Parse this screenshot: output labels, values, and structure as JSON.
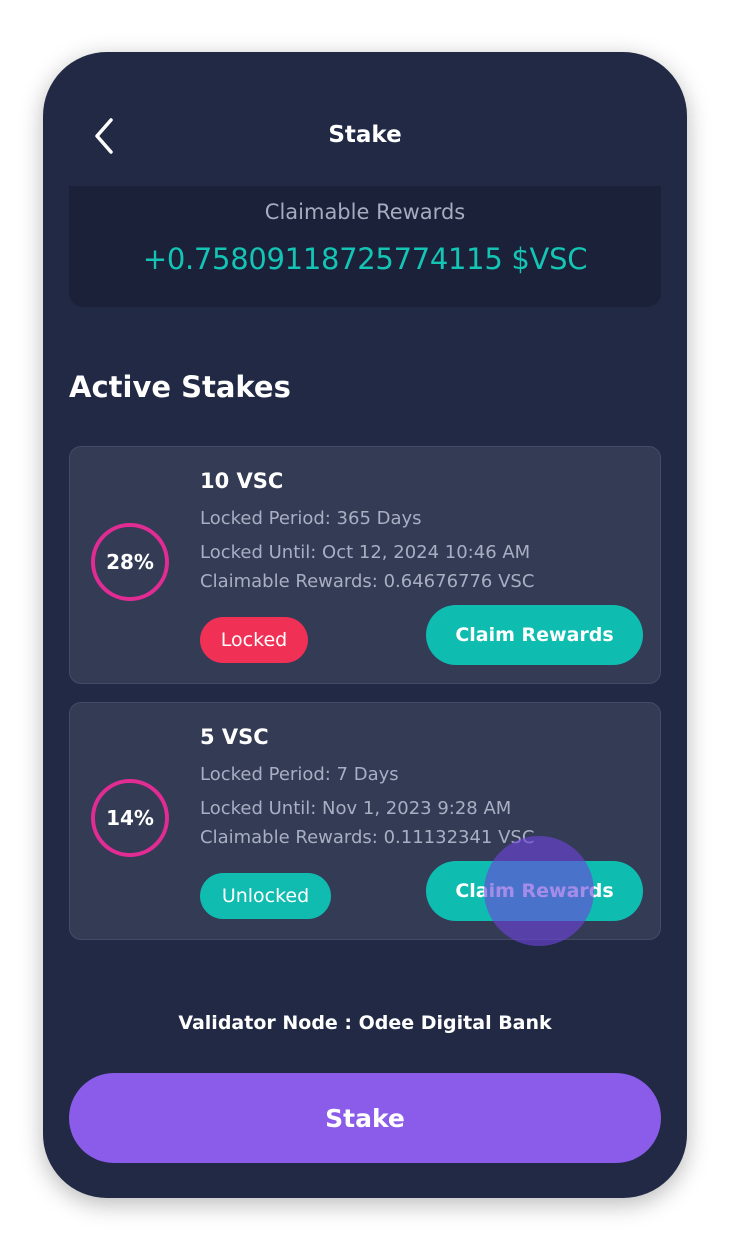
{
  "header": {
    "title": "Stake",
    "back_icon": "chevron-left-icon"
  },
  "rewards": {
    "label": "Claimable Rewards",
    "value": "+0.75809118725774115 $VSC"
  },
  "active_stakes": {
    "title": "Active Stakes",
    "items": [
      {
        "percent": "28%",
        "amount": "10 VSC",
        "locked_period": "Locked Period: 365 Days",
        "locked_until": "Locked Until: Oct 12, 2024 10:46 AM",
        "claimable": "Claimable Rewards: 0.64676776 VSC",
        "status": "Locked",
        "claim_label": "Claim Rewards"
      },
      {
        "percent": "14%",
        "amount": "5 VSC",
        "locked_period": "Locked Period: 7 Days",
        "locked_until": "Locked Until: Nov 1, 2023 9:28 AM",
        "claimable": "Claimable Rewards: 0.11132341 VSC",
        "status": "Unlocked",
        "claim_label": "Claim Rewards"
      }
    ]
  },
  "validator": "Validator Node : Odee Digital Bank",
  "stake_button": "Stake",
  "colors": {
    "background": "#212944",
    "accent_teal": "#0fbdb0",
    "ring_pink": "#e02c93",
    "locked_red": "#f13056",
    "primary_purple": "#8a5ce9"
  }
}
